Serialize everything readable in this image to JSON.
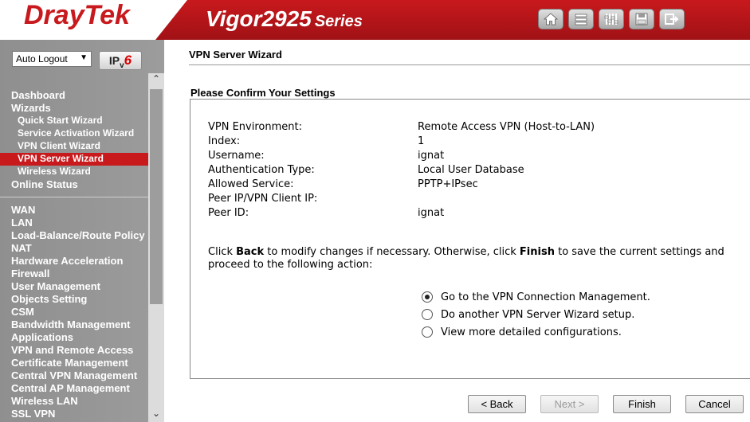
{
  "header": {
    "brand": "DrayTek",
    "product": "Vigor2925",
    "series": "Series",
    "icons": [
      "home-icon",
      "quick-access-icon",
      "settings-sliders-icon",
      "save-icon",
      "logout-icon"
    ]
  },
  "sidebar": {
    "auto_logout": "Auto Logout",
    "ipv6_prefix": "IP",
    "ipv6_v": "v",
    "ipv6_six": "6",
    "menu": [
      {
        "label": "Dashboard",
        "sub": false
      },
      {
        "label": "Wizards",
        "sub": false
      },
      {
        "label": "Quick Start Wizard",
        "sub": true
      },
      {
        "label": "Service Activation Wizard",
        "sub": true
      },
      {
        "label": "VPN Client Wizard",
        "sub": true
      },
      {
        "label": "VPN Server Wizard",
        "sub": true,
        "active": true
      },
      {
        "label": "Wireless Wizard",
        "sub": true
      },
      {
        "label": "Online Status",
        "sub": false
      }
    ],
    "menu2": [
      "WAN",
      "LAN",
      "Load-Balance/Route Policy",
      "NAT",
      "Hardware Acceleration",
      "Firewall",
      "User Management",
      "Objects Setting",
      "CSM",
      "Bandwidth Management",
      "Applications",
      "VPN and Remote Access",
      "Certificate Management",
      "Central VPN Management",
      "Central AP Management",
      "Wireless LAN",
      "SSL VPN"
    ]
  },
  "main": {
    "page_title": "VPN Server Wizard",
    "section_title": "Please Confirm Your Settings",
    "settings": [
      {
        "key": "VPN Environment:",
        "value": "Remote Access VPN (Host-to-LAN)"
      },
      {
        "key": "Index:",
        "value": "1"
      },
      {
        "key": "Username:",
        "value": "ignat"
      },
      {
        "key": "Authentication Type:",
        "value": "Local User Database"
      },
      {
        "key": "Allowed Service:",
        "value": "PPTP+IPsec"
      },
      {
        "key": "Peer IP/VPN Client IP:",
        "value": ""
      },
      {
        "key": "Peer ID:",
        "value": "ignat"
      }
    ],
    "note": {
      "p1": "Click ",
      "back": "Back",
      "p2": " to modify changes if necessary. Otherwise, click ",
      "finish": "Finish",
      "p3": " to save the current settings and proceed to the following action:"
    },
    "options": [
      {
        "label": "Go to the VPN Connection Management.",
        "checked": true
      },
      {
        "label": "Do another VPN Server Wizard setup.",
        "checked": false
      },
      {
        "label": "View more detailed configurations.",
        "checked": false
      }
    ],
    "buttons": {
      "back": "< Back",
      "next": "Next >",
      "finish": "Finish",
      "cancel": "Cancel"
    }
  }
}
